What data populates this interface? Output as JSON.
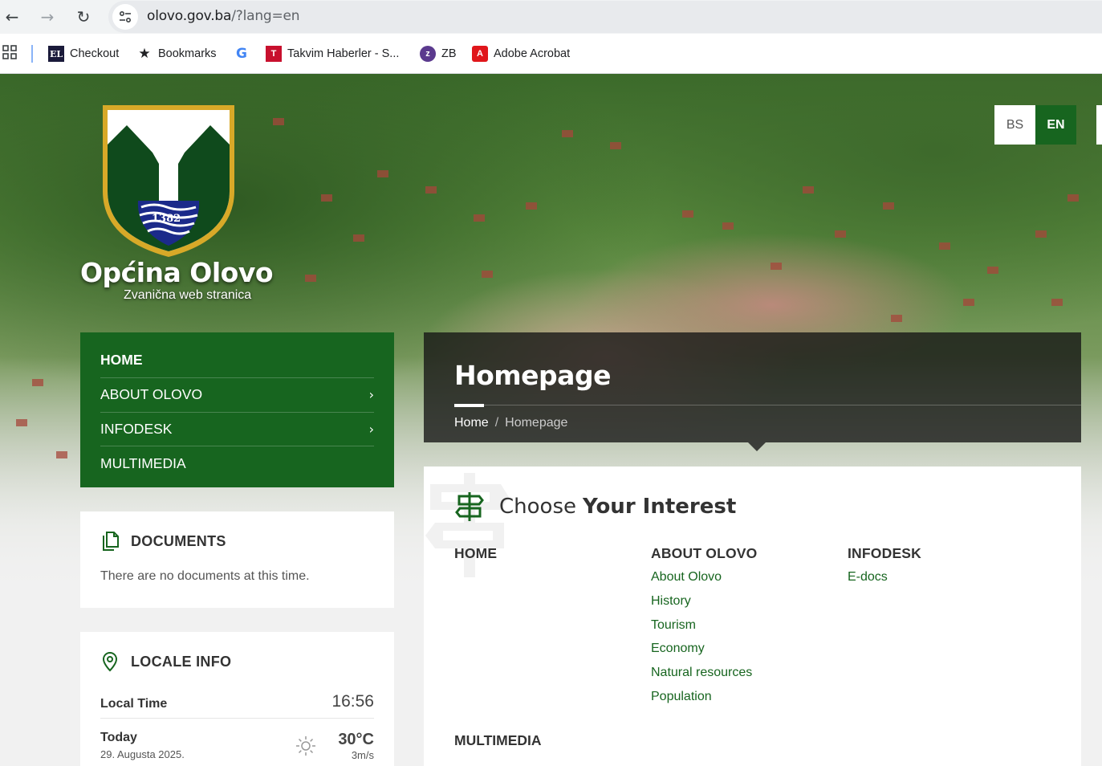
{
  "browser": {
    "url_host": "olovo.gov.ba",
    "url_path": "/?lang=en",
    "bookmarks": [
      {
        "label": "Checkout",
        "icon": "el-icon"
      },
      {
        "label": "Bookmarks",
        "icon": "star-icon"
      },
      {
        "label": "",
        "icon": "google-icon"
      },
      {
        "label": "Takvim Haberler - S...",
        "icon": "takvim-icon"
      },
      {
        "label": "ZB",
        "icon": "zb-icon"
      },
      {
        "label": "Adobe Acrobat",
        "icon": "adobe-acrobat-icon"
      }
    ]
  },
  "site": {
    "logo_year": "1382",
    "title": "Općina Olovo",
    "subtitle": "Zvanična web stranica",
    "languages": [
      "BS",
      "EN"
    ],
    "active_language": "EN",
    "menu": [
      {
        "label": "HOME",
        "active": true,
        "has_children": false
      },
      {
        "label": "ABOUT OLOVO",
        "active": false,
        "has_children": true
      },
      {
        "label": "INFODESK",
        "active": false,
        "has_children": true
      },
      {
        "label": "MULTIMEDIA",
        "active": false,
        "has_children": false
      }
    ],
    "documents": {
      "title": "DOCUMENTS",
      "empty_text": "There are no documents at this time."
    },
    "locale": {
      "title": "LOCALE INFO",
      "local_time_label": "Local Time",
      "local_time": "16:56",
      "today_label": "Today",
      "date": "29. Augusta 2025.",
      "temperature": "30°C",
      "wind": "3m/s",
      "weather_icon": "sun-icon"
    },
    "page": {
      "heading": "Homepage",
      "breadcrumb": [
        "Home",
        "Homepage"
      ]
    },
    "interest": {
      "title_plain": "Choose",
      "title_bold": "Your Interest",
      "columns": [
        {
          "heading": "HOME",
          "links": []
        },
        {
          "heading": "ABOUT OLOVO",
          "links": [
            "About Olovo",
            "History",
            "Tourism",
            "Economy",
            "Natural resources",
            "Population"
          ]
        },
        {
          "heading": "INFODESK",
          "links": [
            "E-docs"
          ]
        }
      ],
      "next_heading": "MULTIMEDIA"
    },
    "colors": {
      "brand_green": "#17651f",
      "dark_overlay": "#141414"
    }
  }
}
